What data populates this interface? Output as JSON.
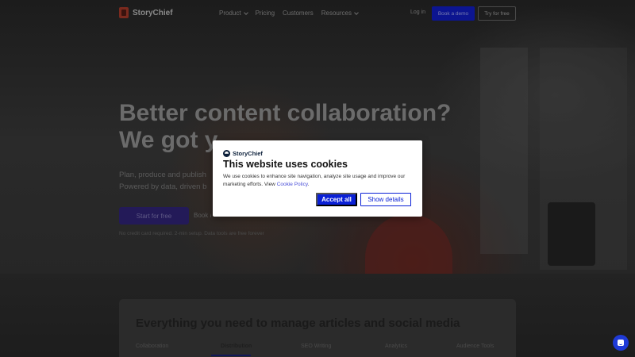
{
  "nav": {
    "brand": "StoryChief",
    "links": [
      {
        "label": "Product",
        "has_dropdown": true
      },
      {
        "label": "Pricing",
        "has_dropdown": false
      },
      {
        "label": "Customers",
        "has_dropdown": false
      },
      {
        "label": "Resources",
        "has_dropdown": true
      }
    ],
    "login": "Log in",
    "book_demo": "Book a demo",
    "try_free": "Try for free"
  },
  "hero": {
    "headline_1": "Better content collaboration?",
    "headline_2": "We got y",
    "sub_1": "Plan, produce and publish",
    "sub_2": "Powered by data, driven b",
    "cta_start": "Start for free",
    "cta_book": "Book a",
    "fineprint": "No credit card required. 2-min setup. Data tools are free forever"
  },
  "features": {
    "title": "Everything you need to manage articles and social media",
    "tabs": [
      "Collaboration",
      "Distribution",
      "SEO Writing",
      "Analytics",
      "Audience Tools"
    ],
    "active_tab": "Distribution"
  },
  "cookie": {
    "brand": "StoryChief",
    "title": "This website uses cookies",
    "body": "We use cookies to enhance site navigation, analyze site usage and improve our marketing efforts. View ",
    "link": "Cookie Policy",
    "body_end": ".",
    "accept": "Accept all",
    "details": "Show details"
  },
  "colors": {
    "accent": "#0a20d6",
    "overlay": "#000000"
  },
  "icons": {
    "chat": "chat-bubble-icon",
    "brand": "storychief-logo-icon"
  }
}
